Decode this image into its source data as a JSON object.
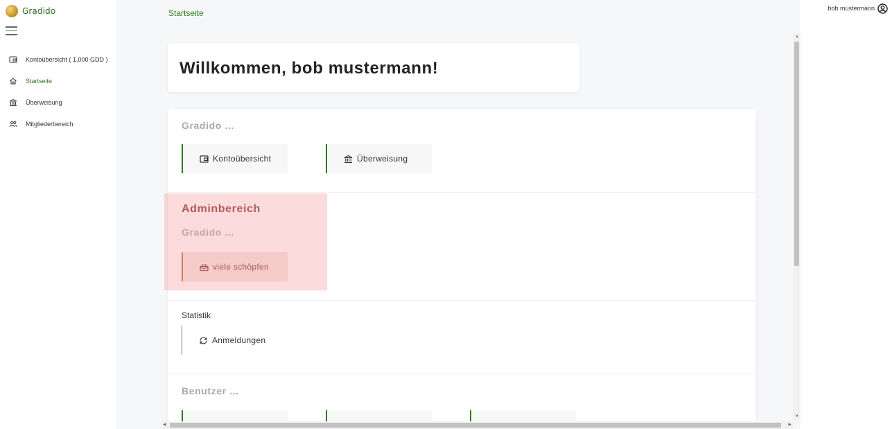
{
  "brand": {
    "name": "Gradido"
  },
  "sidebar": {
    "items": [
      {
        "label": "Kontoübersicht ( 1,000 GDD )",
        "icon": "wallet-icon",
        "active": false
      },
      {
        "label": "Startseite",
        "icon": "home-icon",
        "active": true
      },
      {
        "label": "Überweisung",
        "icon": "bank-icon",
        "active": false
      },
      {
        "label": "Mitgliederbereich",
        "icon": "people-icon",
        "active": false
      }
    ]
  },
  "breadcrumb": {
    "label": "Startseite"
  },
  "user": {
    "name": "bob mustermann",
    "icon": "user-circle-icon"
  },
  "welcome": {
    "title": "Willkommen, bob mustermann!"
  },
  "sections": {
    "gradido": {
      "title": "Gradido ...",
      "tiles": [
        {
          "label": "Kontoübersicht",
          "icon": "wallet-icon"
        },
        {
          "label": "Überweisung",
          "icon": "bank-icon"
        }
      ]
    },
    "admin": {
      "title": "Adminbereich",
      "subtitle": "Gradido ...",
      "tiles": [
        {
          "label": "viele schöpfen",
          "icon": "cake-icon"
        }
      ]
    },
    "stats": {
      "title": "Statistik",
      "tiles": [
        {
          "label": "Anmeldungen",
          "icon": "refresh-icon"
        }
      ]
    },
    "users": {
      "title": "Benutzer ..."
    }
  },
  "colors": {
    "accent": "#2e7d1e",
    "admin_text": "#8b2b2b",
    "admin_border": "#a8752a",
    "highlight": "#f5a0a0"
  }
}
